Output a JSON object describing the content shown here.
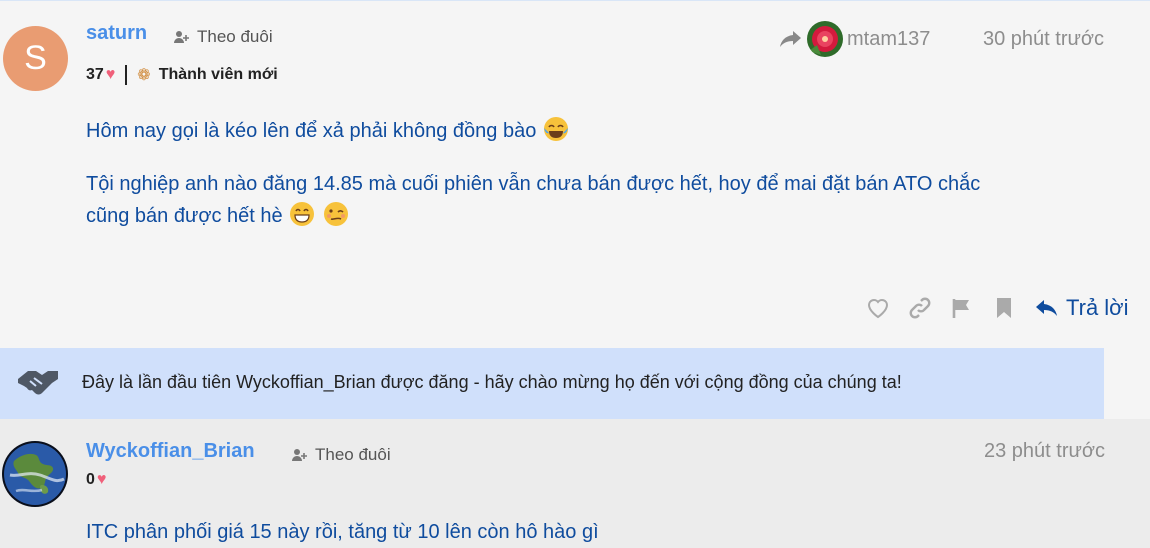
{
  "post1": {
    "avatar_letter": "S",
    "username": "saturn",
    "follow_label": "Theo đuôi",
    "likes_count": "37",
    "badge_label": "Thành viên mới",
    "reply_to_user": "mtam137",
    "timestamp": "30 phút trước",
    "line1": "Hôm nay gọi là kéo lên để xả phải không đồng bào",
    "line2": "Tội nghiệp anh nào đăng 14.85 mà cuối phiên vẫn chưa bán được hết, hoy để mai đặt bán ATO chắc",
    "line3": "cũng bán được hết hè",
    "reply_label": "Trả lời"
  },
  "notice": {
    "text": "Đây là lần đầu tiên Wyckoffian_Brian được đăng - hãy chào mừng họ đến với cộng đồng của chúng ta!"
  },
  "post2": {
    "username": "Wyckoffian_Brian",
    "follow_label": "Theo đuôi",
    "likes_count": "0",
    "timestamp": "23 phút trước",
    "text": "ITC phân phối giá 15 này rồi, tăng từ 10 lên còn hô hào gì"
  },
  "colors": {
    "link_blue": "#4a8fe8",
    "text_blue": "#0f4c9e",
    "heart": "#f0607a",
    "notice_bg": "#d0e0fb",
    "avatar_orange": "#e99c72"
  },
  "icons": [
    "follow-icon",
    "heart-icon",
    "badge-icon",
    "reply-arrow-icon",
    "like-icon",
    "link-icon",
    "flag-icon",
    "bookmark-icon",
    "reply-icon",
    "handshake-icon"
  ]
}
